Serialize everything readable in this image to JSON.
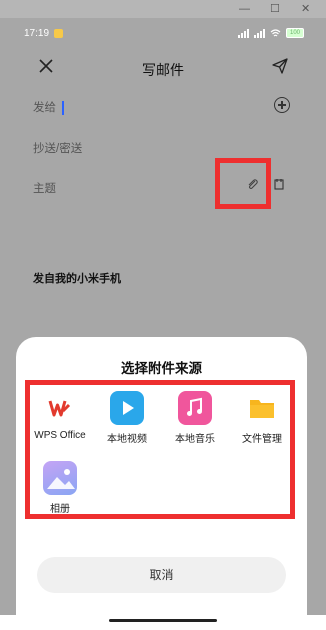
{
  "status": {
    "time": "17:19",
    "battery": "100"
  },
  "header": {
    "title": "写邮件"
  },
  "form": {
    "to_label": "发给",
    "cc_label": "抄送/密送",
    "subject_label": "主题",
    "signature": "发自我的小米手机"
  },
  "sheet": {
    "title": "选择附件来源",
    "options": [
      {
        "label": "WPS Office",
        "icon": "wps-office-icon",
        "color": "#e23a2e"
      },
      {
        "label": "本地视频",
        "icon": "play-video-icon",
        "color": "#2aa7ea"
      },
      {
        "label": "本地音乐",
        "icon": "music-note-icon",
        "color": "#f0569c"
      },
      {
        "label": "文件管理",
        "icon": "folder-icon",
        "color": "#f7b51e"
      },
      {
        "label": "相册",
        "icon": "photo-album-icon",
        "color": "#8aa5f3"
      }
    ],
    "cancel_label": "取消"
  },
  "colors": {
    "highlight": "#ee2f2f",
    "dim_overlay": "#a7a7a7",
    "cursor": "#2b62ff"
  }
}
